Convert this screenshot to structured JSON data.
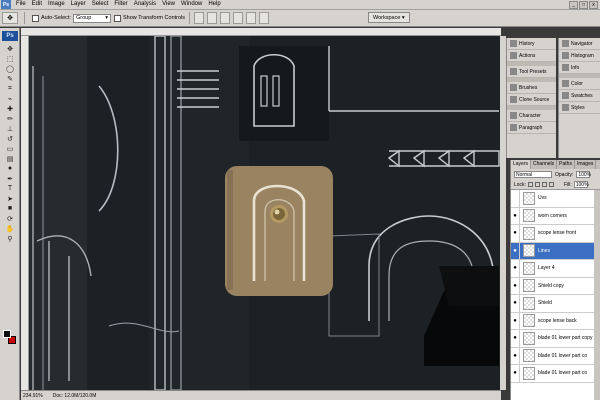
{
  "menubar": {
    "app_icon": "Ps",
    "items": [
      "File",
      "Edit",
      "Image",
      "Layer",
      "Select",
      "Filter",
      "Analysis",
      "View",
      "Window",
      "Help"
    ],
    "window_controls": [
      "_",
      "□",
      "x"
    ]
  },
  "options_bar": {
    "auto_select_label": "Auto-Select:",
    "auto_select_value": "Group",
    "show_transform_label": "Show Transform Controls",
    "workspace_label": "Workspace ▾"
  },
  "toolbox": {
    "badge": "Ps",
    "tools": [
      "move",
      "marquee",
      "lasso",
      "quick-select",
      "crop",
      "eyedropper",
      "healing",
      "brush",
      "clone",
      "history-brush",
      "eraser",
      "gradient",
      "dodge",
      "pen",
      "type",
      "path-select",
      "shape",
      "hand",
      "zoom"
    ]
  },
  "status": {
    "zoom": "234.91%",
    "doc": "Doc: 12.0M/120.0M"
  },
  "panels_left": [
    "History",
    "Actions",
    "Tool Presets",
    "Brushes",
    "Clone Source",
    "Character",
    "Paragraph"
  ],
  "panels_right": [
    "Navigator",
    "Histogram",
    "Info",
    "Color",
    "Swatches",
    "Styles"
  ],
  "layers_panel": {
    "tabs": [
      "Layers",
      "Channels",
      "Paths",
      "Images"
    ],
    "blend_mode": "Normal",
    "opacity_label": "Opacity:",
    "opacity_value": "100%",
    "lock_label": "Lock:",
    "fill_label": "Fill:",
    "fill_value": "100%",
    "layers": [
      {
        "name": "Uvs",
        "visible": false,
        "selected": false
      },
      {
        "name": "worn corners",
        "visible": true,
        "selected": false
      },
      {
        "name": "scope lense front",
        "visible": true,
        "selected": false
      },
      {
        "name": "Lines",
        "visible": true,
        "selected": true
      },
      {
        "name": "Layer 4",
        "visible": true,
        "selected": false
      },
      {
        "name": "Shield copy",
        "visible": true,
        "selected": false
      },
      {
        "name": "Shield",
        "visible": true,
        "selected": false
      },
      {
        "name": "scope lense back",
        "visible": true,
        "selected": false
      },
      {
        "name": "blade 01 lower part copy",
        "visible": true,
        "selected": false
      },
      {
        "name": "blade 01 lower part co",
        "visible": true,
        "selected": false
      },
      {
        "name": "blade 01 lower part co",
        "visible": true,
        "selected": false
      }
    ]
  },
  "colors": {
    "foreground": "#111111",
    "background": "#cc0000",
    "selection": "#3b6fc4",
    "canvas_bg": "#1c2125",
    "tan_patch": "#9a8361"
  }
}
